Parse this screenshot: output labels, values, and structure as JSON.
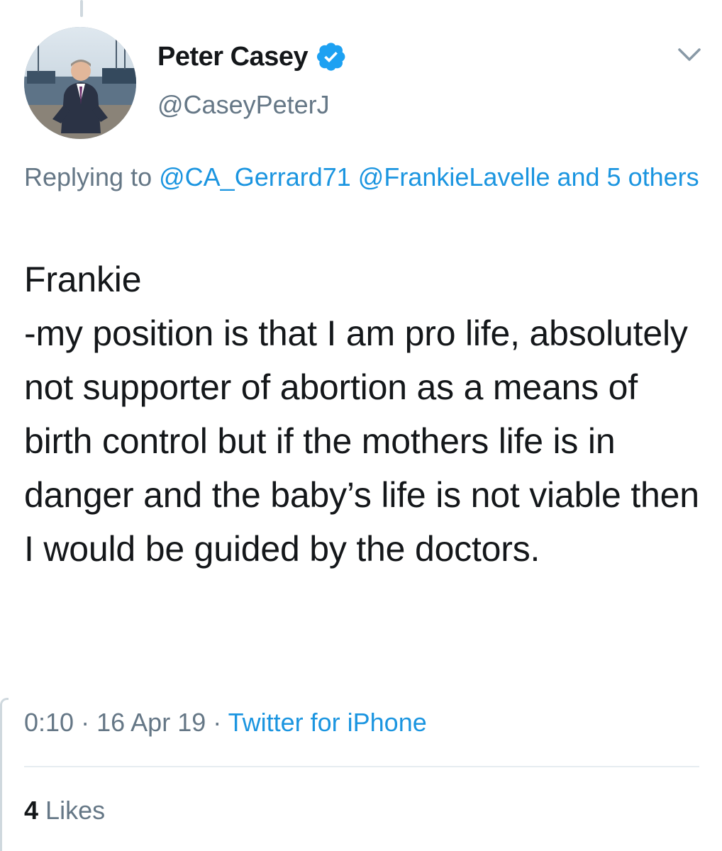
{
  "tweet": {
    "author": {
      "display_name": "Peter Casey",
      "handle": "@CaseyPeterJ",
      "verified_icon": "verified-badge-icon",
      "avatar": "avatar"
    },
    "replying": {
      "prefix": "Replying to",
      "mentions": [
        "@CA_Gerrard71",
        "@FrankieLavelle"
      ],
      "and_text": "and 5 others"
    },
    "text": "Frankie\n-my position is that I am pro life, absolutely not supporter of abortion as a means of birth control but if the mothers life is in danger and the baby’s life is not viable then I would be guided by the doctors.",
    "time": "0:10",
    "separator": "·",
    "date": "16 Apr 19",
    "source": "Twitter for iPhone",
    "likes_count": "4",
    "likes_label": "Likes"
  },
  "colors": {
    "primary_text": "#14171a",
    "secondary_text": "#657786",
    "link": "#1b95e0",
    "verified": "#1da1f2",
    "divider": "#e6ecf0"
  },
  "icons": {
    "menu": "chevron-down-icon"
  }
}
